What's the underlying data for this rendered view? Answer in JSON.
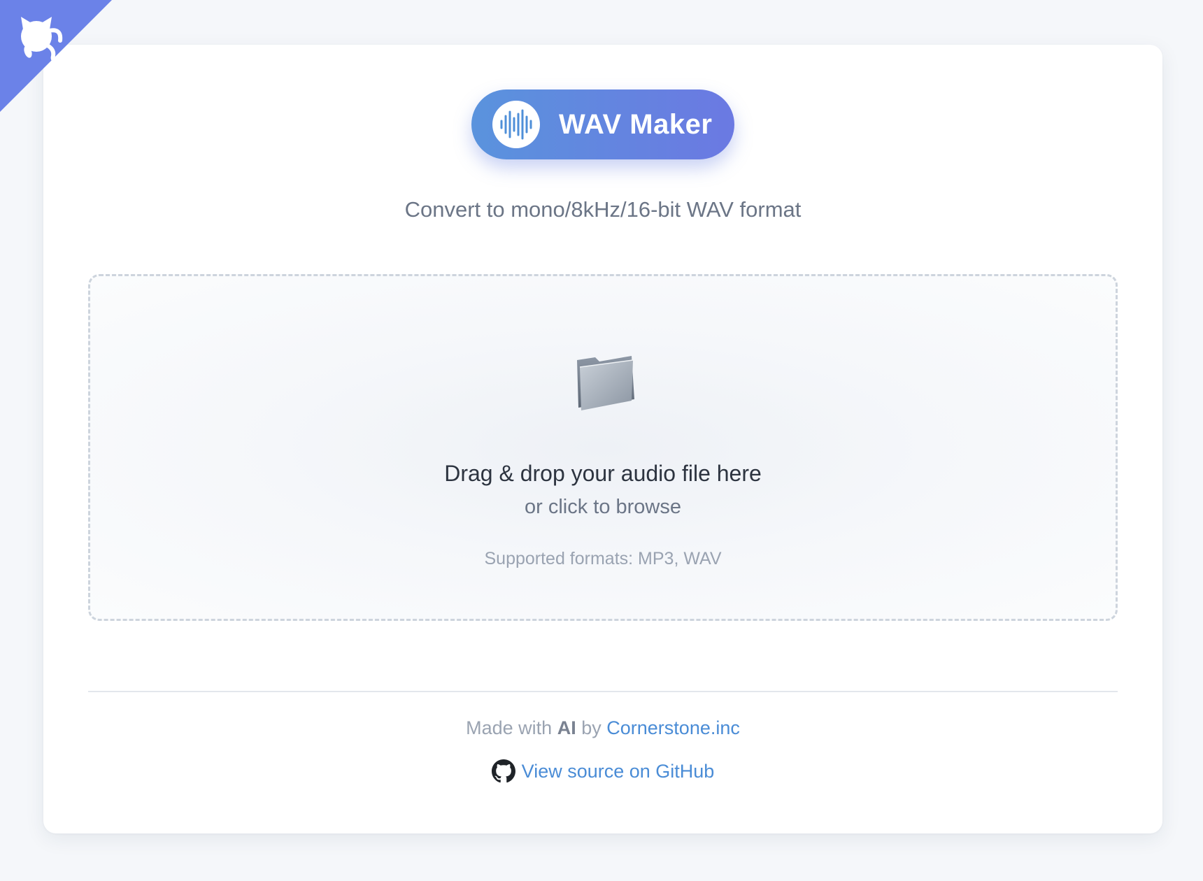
{
  "corner_ribbon": {
    "icon": "github-octocat-icon",
    "color": "#6b82e8"
  },
  "header": {
    "title": "WAV Maker",
    "logo_icon": "waveform-icon",
    "subtitle": "Convert to mono/8kHz/16-bit WAV format"
  },
  "dropzone": {
    "icon": "folder-icon",
    "title": "Drag & drop your audio file here",
    "browse_text": "or click to browse",
    "formats_text": "Supported formats: MP3, WAV"
  },
  "footer": {
    "made_with_prefix": "Made with",
    "made_with_ai": "AI",
    "made_with_by": "by",
    "company_link": "Cornerstone.inc",
    "source_icon": "github-icon",
    "source_link": "View source on GitHub"
  },
  "colors": {
    "accent_start": "#5a93dd",
    "accent_end": "#6b79e2",
    "link": "#4a8cd6",
    "background": "#f5f7fa"
  }
}
